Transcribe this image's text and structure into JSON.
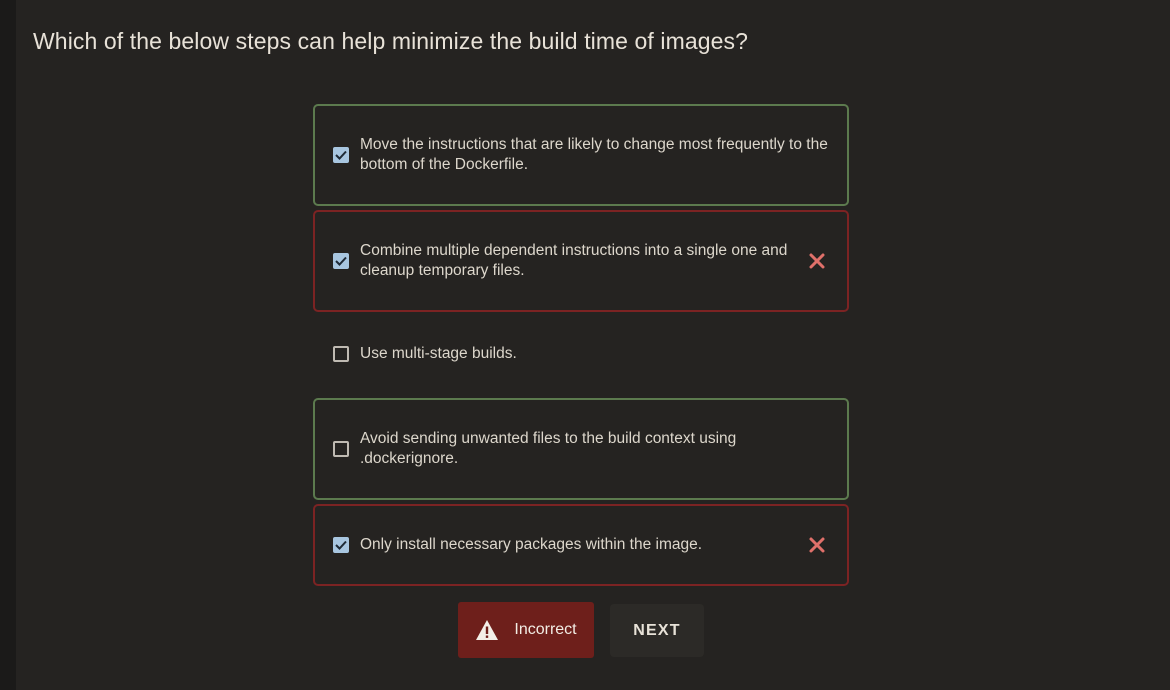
{
  "question": "Which of the below steps can help minimize the build time of images?",
  "options": [
    {
      "text": "Move the instructions that are likely to change most frequently to the bottom of the Dockerfile.",
      "checked": true,
      "status": "correct"
    },
    {
      "text": "Combine multiple dependent instructions into a single one and cleanup temporary files.",
      "checked": true,
      "status": "wrong"
    },
    {
      "text": "Use multi-stage builds.",
      "checked": false,
      "status": "none"
    },
    {
      "text": "Avoid sending unwanted files to the build context using .dockerignore.",
      "checked": false,
      "status": "correct"
    },
    {
      "text": "Only install necessary packages within the image.",
      "checked": true,
      "status": "wrong"
    }
  ],
  "feedback": {
    "label": "Incorrect",
    "icon": "warning-triangle-icon"
  },
  "next_label": "NEXT",
  "colors": {
    "correct_border": "#5c7a4e",
    "wrong_border": "#7c2323",
    "checkbox_fill": "#a8c6e0",
    "x_mark": "#e0706a",
    "incorrect_bg": "#6e1f1b"
  }
}
